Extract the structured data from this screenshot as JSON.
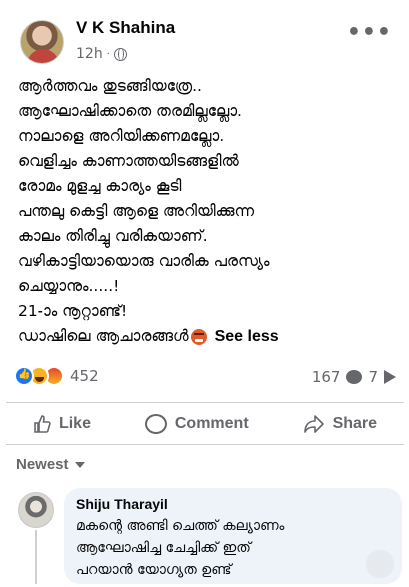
{
  "post": {
    "author": "V K Shahina",
    "time": "12h",
    "dot": "·",
    "more": "•••",
    "lines": [
      "ആർത്തവം തുടങ്ങിയത്രേ..",
      "ആഘോഷിക്കാതെ തരമില്ലല്ലോ.",
      "നാലാളെ അറിയിക്കണമല്ലോ.",
      "വെളിച്ചം കാണാത്തയിടങ്ങളിൽ",
      "രോമം മുളച്ച കാര്യം കൂടി",
      "പന്തലു കെട്ടി ആളെ അറിയിക്കുന്ന",
      "കാലം തിരിച്ചു വരികയാണ്.",
      "വഴികാട്ടിയായൊരു വാരിക പരസ്യം",
      "ചെയ്യാനും.....!",
      "21-ാം നൂറ്റാണ്ട്!"
    ],
    "last_line": "ഡാഷിലെ ആചാരങ്ങൾ",
    "see_less": "See less"
  },
  "stats": {
    "reaction_count": "452",
    "comment_count": "167",
    "share_count": "7"
  },
  "actions": {
    "like": "Like",
    "comment": "Comment",
    "share": "Share"
  },
  "sort": {
    "label": "Newest"
  },
  "comment": {
    "author": "Shiju Tharayil",
    "lines": [
      "മകന്റെ അണ്ടി ചെത്ത് കല്യാണം",
      "ആഘോഷിച്ച ചേച്ചിക്ക് ഇത്",
      "പറയാൻ യോഗ്യത ഉണ്ട്"
    ]
  },
  "colors": {
    "text": "#050505",
    "secondary": "#65676b",
    "like_blue": "#1877f2",
    "comment_bg": "#eef3fa"
  }
}
